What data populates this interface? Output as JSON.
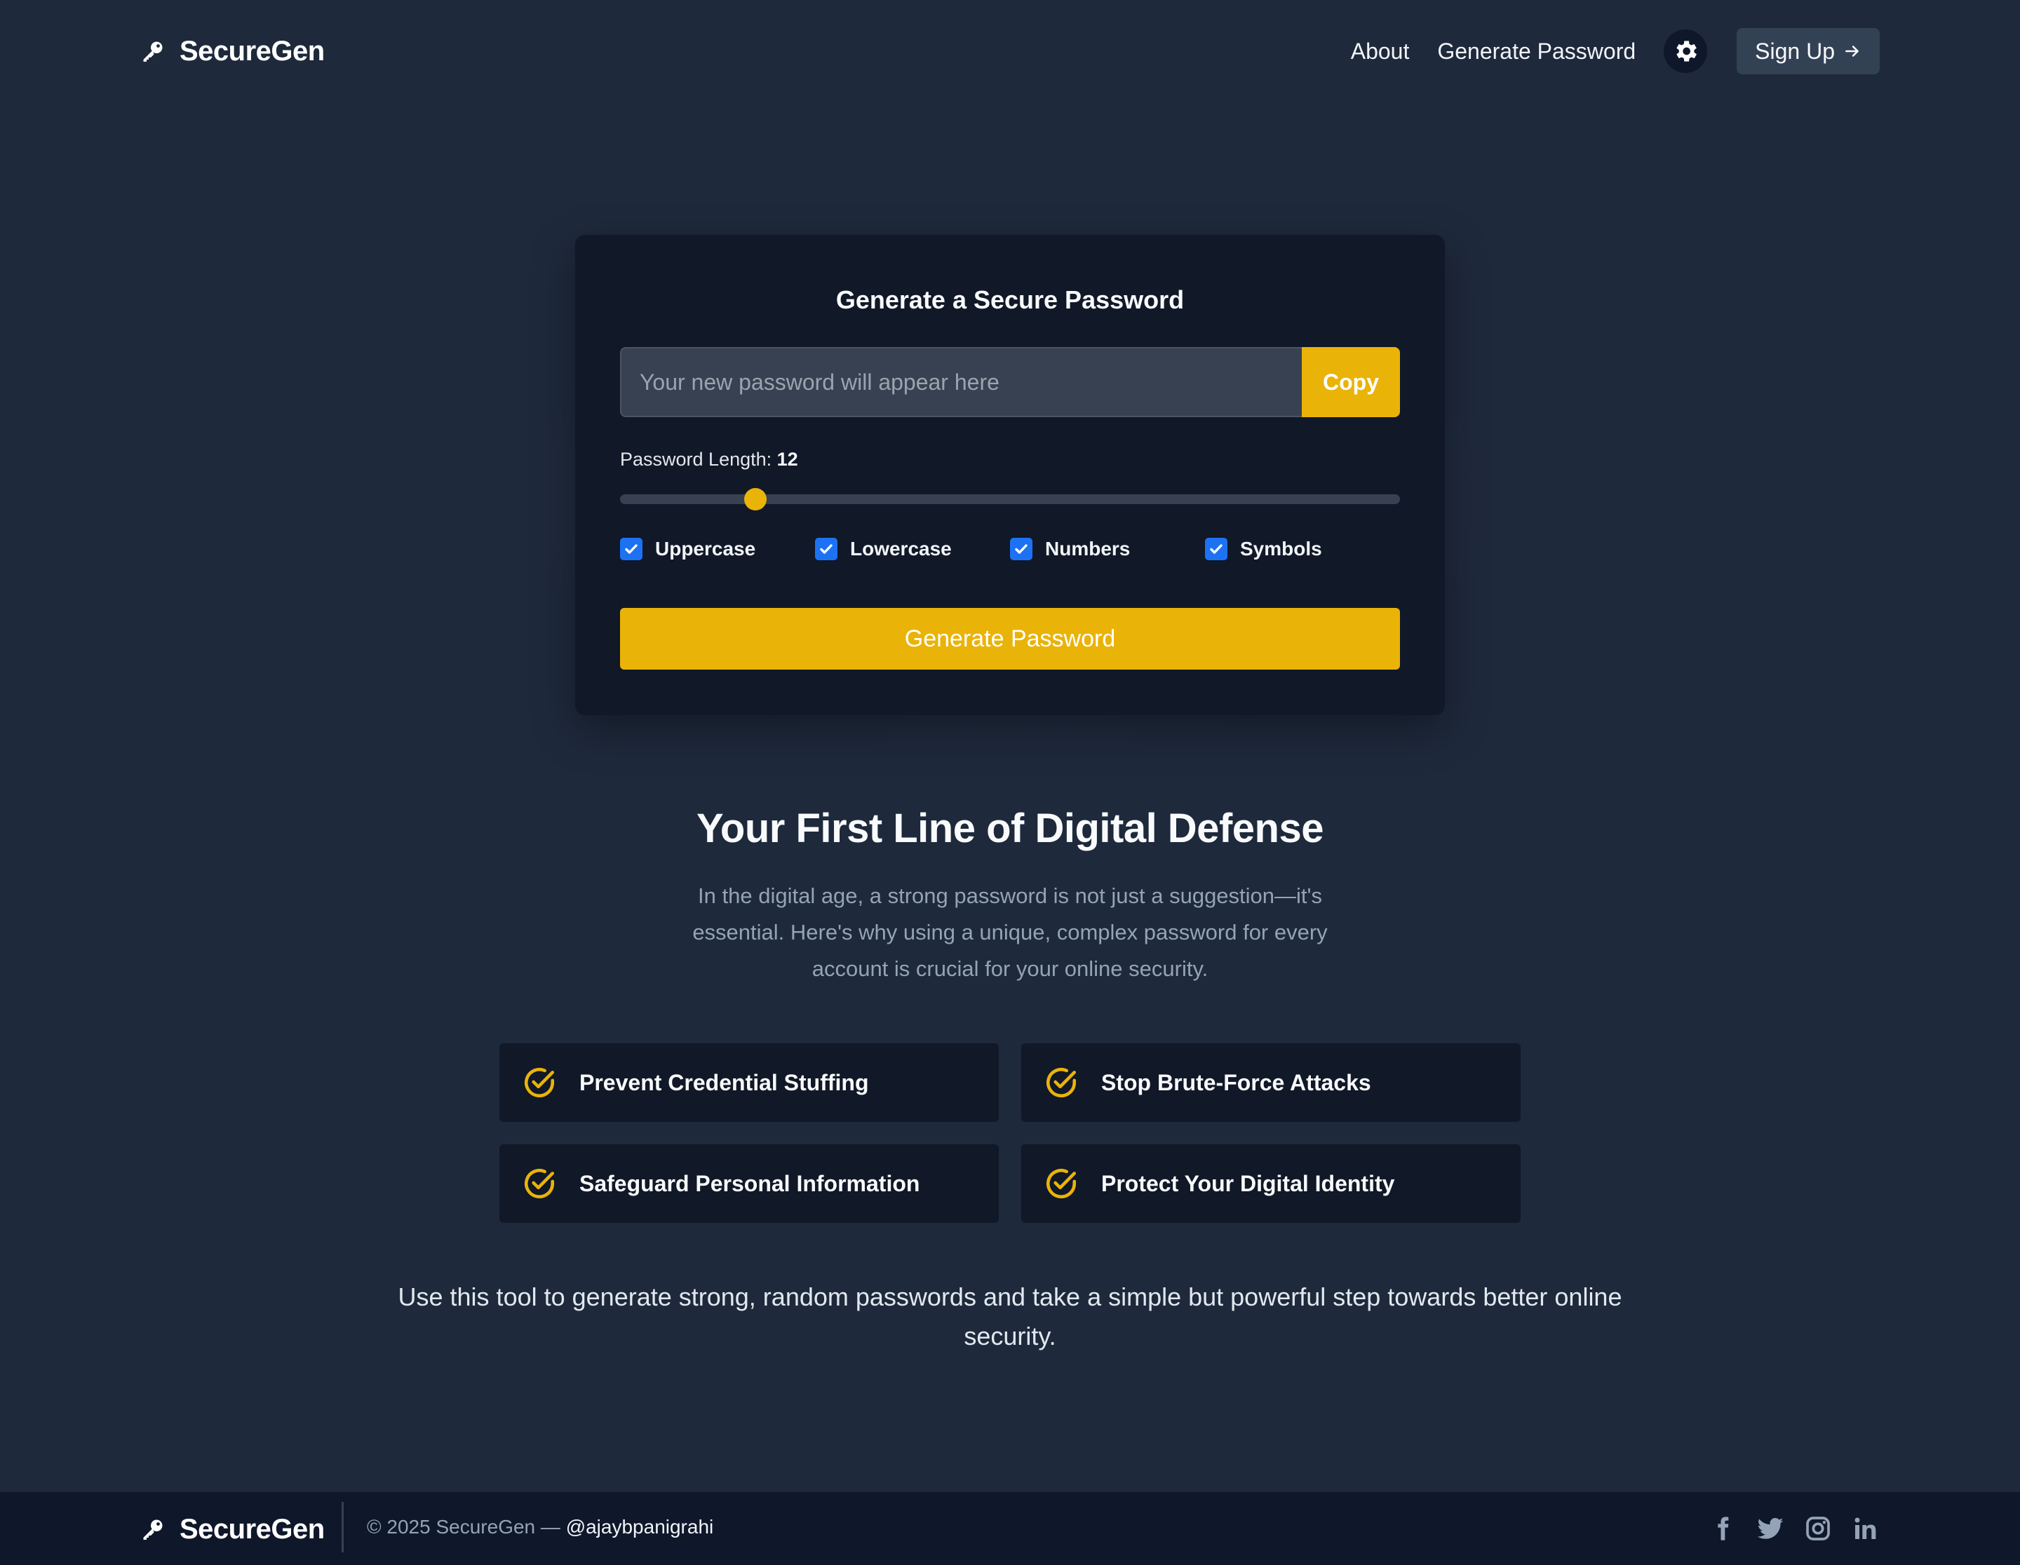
{
  "header": {
    "brand": "SecureGen",
    "nav": [
      "About",
      "Generate Password"
    ],
    "theme_icon": "gear-icon",
    "signup_label": "Sign Up"
  },
  "generator": {
    "title": "Generate a Secure Password",
    "password_value": "",
    "password_placeholder": "Your new password will appear here",
    "copy_label": "Copy",
    "length_label": "Password Length:",
    "length_value": "12",
    "length_min": 4,
    "length_max": 50,
    "options": [
      {
        "label": "Uppercase",
        "checked": true
      },
      {
        "label": "Lowercase",
        "checked": true
      },
      {
        "label": "Numbers",
        "checked": true
      },
      {
        "label": "Symbols",
        "checked": true
      }
    ],
    "generate_label": "Generate Password"
  },
  "info": {
    "title": "Your First Line of Digital Defense",
    "description": "In the digital age, a strong password is not just a suggestion—it's essential. Here's why using a unique, complex password for every account is crucial for your online security.",
    "features": [
      "Prevent Credential Stuffing",
      "Stop Brute-Force Attacks",
      "Safeguard Personal Information",
      "Protect Your Digital Identity"
    ],
    "cta": "Use this tool to generate strong, random passwords and take a simple but powerful step towards better online security."
  },
  "footer": {
    "brand": "SecureGen",
    "copyright": "© 2025 SecureGen — ",
    "handle": "@ajaybpanigrahi",
    "social": [
      "facebook-icon",
      "twitter-icon",
      "instagram-icon",
      "linkedin-icon"
    ]
  },
  "colors": {
    "background": "#1e293b",
    "card": "#111827",
    "accent": "#eab308",
    "checkbox": "#1d72f3",
    "footer": "#0f172a"
  }
}
